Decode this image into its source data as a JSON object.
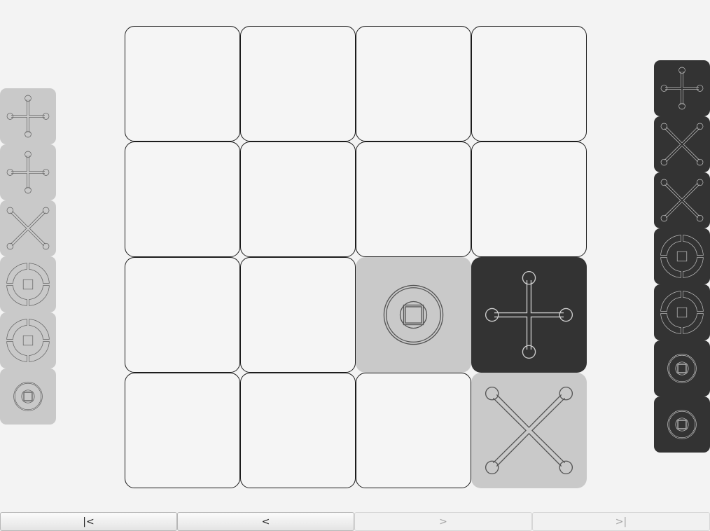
{
  "colors": {
    "background": "#f3f3f3",
    "empty_cell": "#f5f5f5",
    "light_piece": "#c9c9c9",
    "dark_piece": "#333333",
    "light_stroke": "#555555",
    "dark_stroke": "#cfcfcf"
  },
  "board": {
    "rows": 4,
    "cols": 4,
    "placed": [
      {
        "row": 2,
        "col": 2,
        "shape": "ring-square",
        "color": "light"
      },
      {
        "row": 2,
        "col": 3,
        "shape": "plus",
        "color": "dark"
      },
      {
        "row": 3,
        "col": 3,
        "shape": "cross",
        "color": "light"
      }
    ]
  },
  "left_tray": {
    "color": "light",
    "pieces": [
      {
        "shape": "plus"
      },
      {
        "shape": "plus"
      },
      {
        "shape": "cross"
      },
      {
        "shape": "gapped-ring-square"
      },
      {
        "shape": "gapped-ring-square"
      },
      {
        "shape": "ring-square"
      }
    ]
  },
  "right_tray": {
    "color": "dark",
    "pieces": [
      {
        "shape": "plus"
      },
      {
        "shape": "cross"
      },
      {
        "shape": "cross"
      },
      {
        "shape": "gapped-ring-square"
      },
      {
        "shape": "gapped-ring-square"
      },
      {
        "shape": "ring-square"
      },
      {
        "shape": "ring-square"
      }
    ]
  },
  "nav": {
    "first_label": "|<",
    "prev_label": "<",
    "next_label": ">",
    "last_label": ">|",
    "next_enabled": false,
    "last_enabled": false
  }
}
